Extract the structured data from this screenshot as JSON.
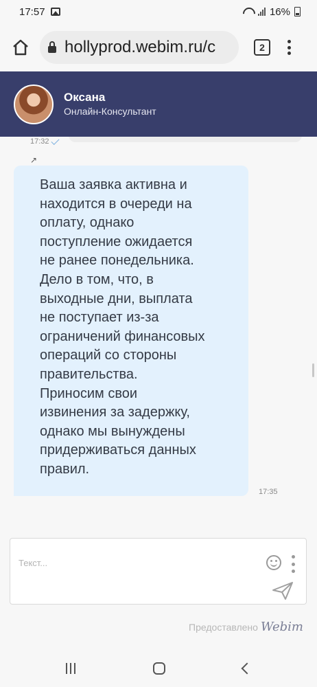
{
  "status_bar": {
    "time": "17:57",
    "battery": "16%"
  },
  "browser": {
    "url": "hollyprod.webim.ru/c",
    "tab_count": "2"
  },
  "chat": {
    "operator_name": "Оксана",
    "operator_role": "Онлайн-Консультант",
    "previous_time": "17:32",
    "reply_icon": "↗",
    "message_text": "Ваша заявка активна и\nнаходится в очереди на\nоплату, однако\nпоступление ожидается\nне ранее понедельника.\nДело в том, что, в\nвыходные дни, выплата\nне поступает из-за\nограничений финансовых\nопераций со стороны\nправительства.\nПриносим свои\nизвинения за задержку,\nоднако мы вынуждены\nпридерживаться данных\nправил.",
    "message_time": "17:35"
  },
  "composer": {
    "placeholder": "Текст..."
  },
  "footer": {
    "powered_by": "Предоставлено",
    "brand": "Webim"
  },
  "icons": {
    "home": "home-icon",
    "lock": "lock-icon",
    "tabs": "tabs-icon",
    "menu": "more-vertical-icon",
    "emoji": "emoji-icon",
    "send": "send-icon",
    "wifi": "wifi-icon",
    "signal": "signal-icon",
    "battery": "battery-icon"
  },
  "colors": {
    "header_bg": "#383e6b",
    "bubble_bg": "#e3f1fd",
    "text": "#343a45"
  }
}
